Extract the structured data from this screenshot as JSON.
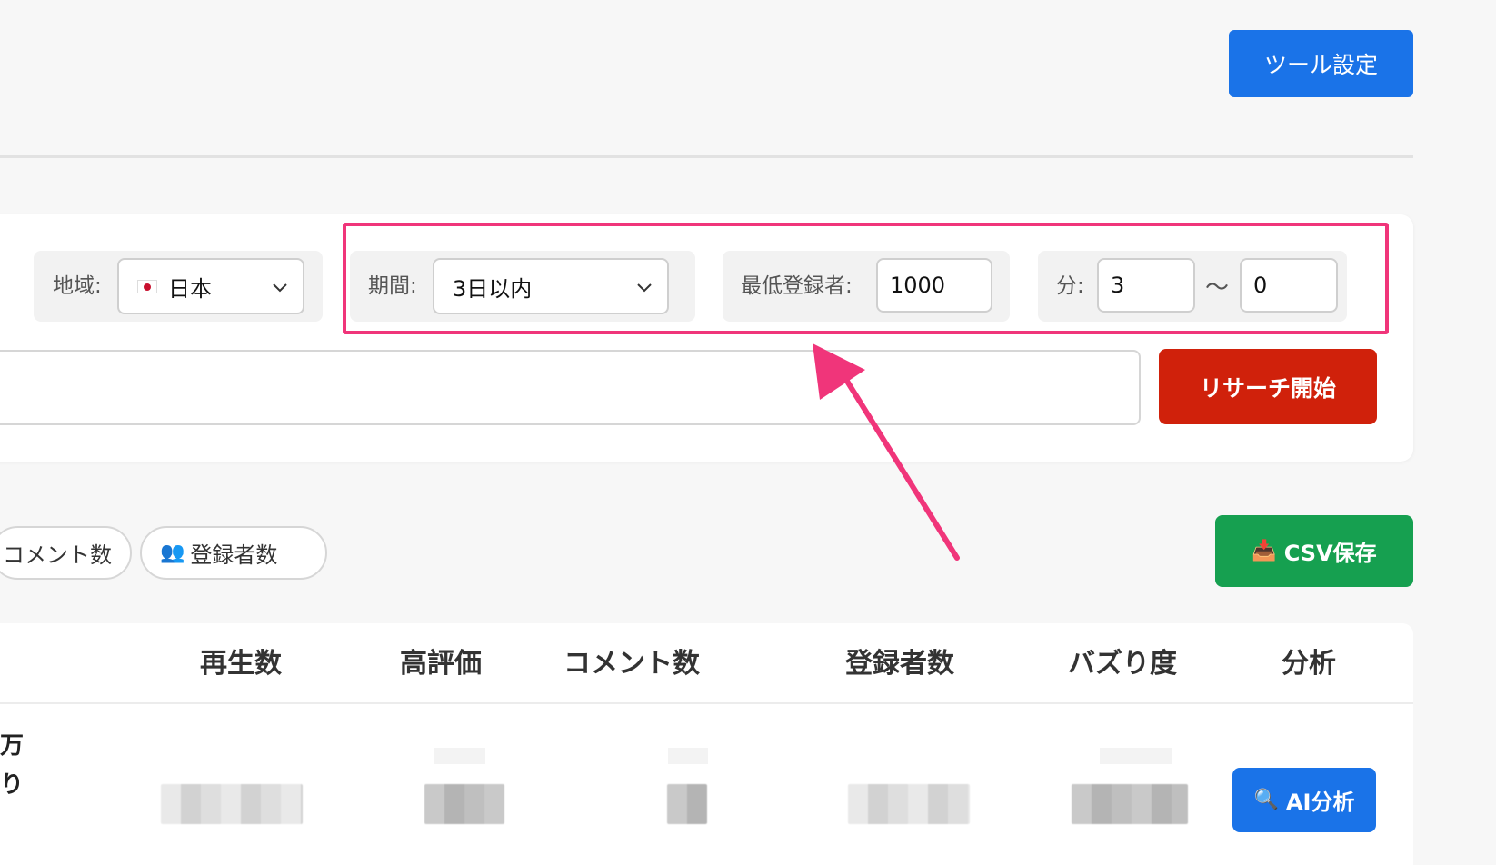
{
  "header": {
    "tool_settings_label": "ツール設定"
  },
  "filters": {
    "region": {
      "label": "地域:",
      "value": "日本"
    },
    "period": {
      "label": "期間:",
      "value": "3日以内"
    },
    "min_subscribers": {
      "label": "最低登録者:",
      "value": "1000"
    },
    "minutes": {
      "label": "分:",
      "from": "3",
      "separator": "〜",
      "to": "0"
    }
  },
  "search": {
    "keyword_value": "",
    "start_label": "リサーチ開始"
  },
  "sort_chips": {
    "comments": "コメント数",
    "subscribers": "登録者数"
  },
  "actions": {
    "csv_label": "CSV保存",
    "ai_label": "AI分析"
  },
  "table": {
    "columns": [
      "再生数",
      "高評価",
      "コメント数",
      "登録者数",
      "バズり度",
      "分析"
    ],
    "row_fragment": [
      "万",
      "り"
    ]
  },
  "colors": {
    "primary": "#1a73e8",
    "danger": "#d0210b",
    "success": "#16a050",
    "highlight": "#f0357a"
  },
  "icons": {
    "csv": "inbox-tray-icon",
    "ai": "magnifier-icon",
    "subscribers": "people-icon",
    "region": "japan-flag-icon"
  }
}
